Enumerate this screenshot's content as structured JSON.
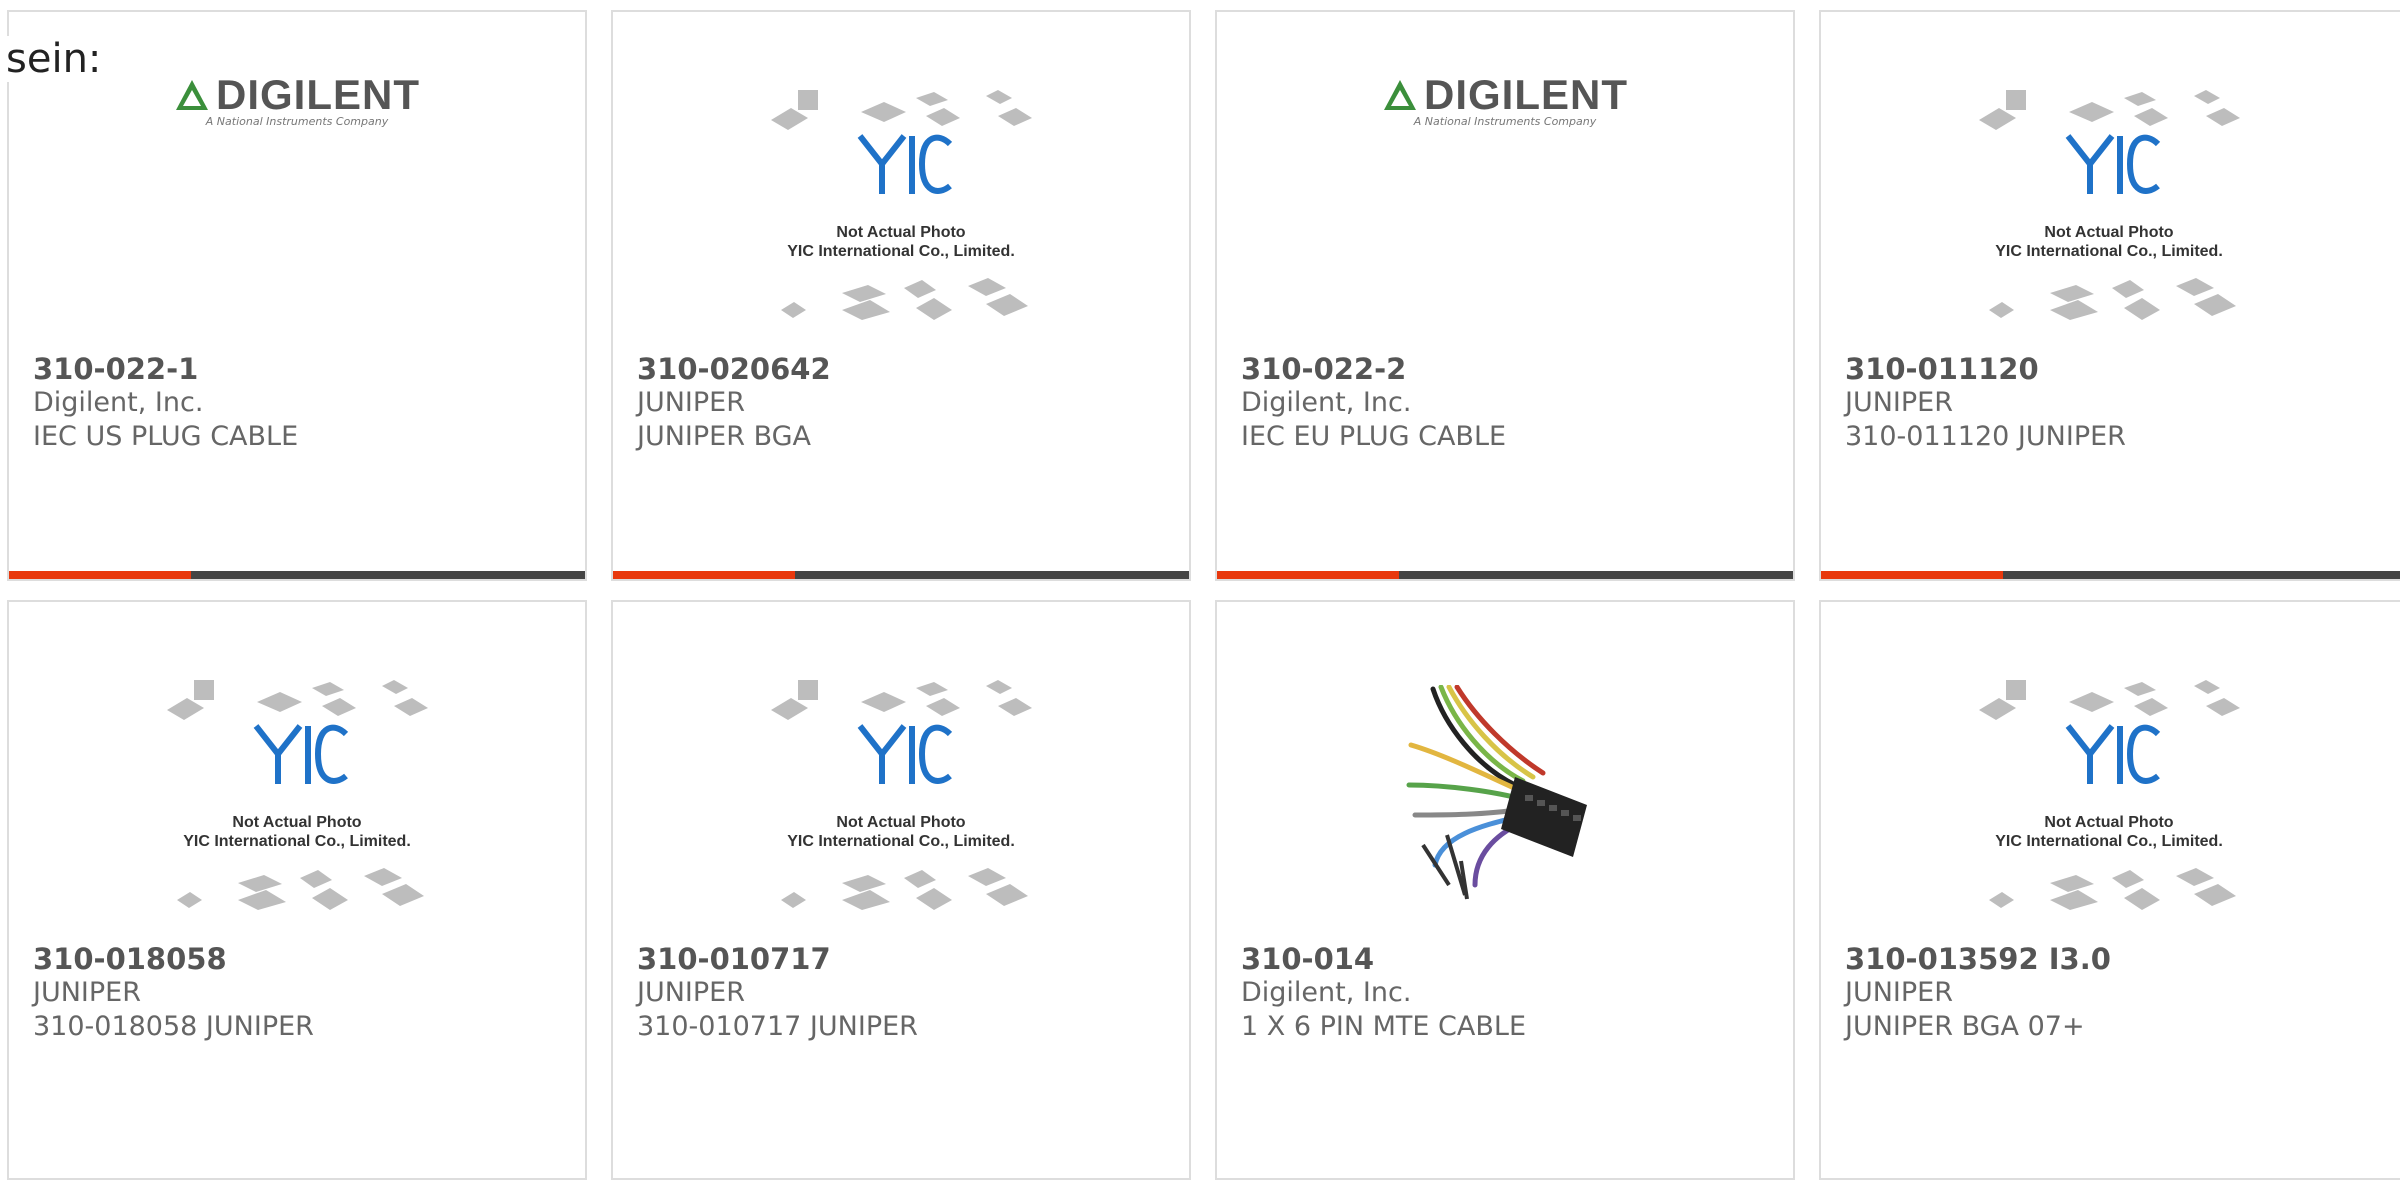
{
  "lead_text": "sein:",
  "placeholder_caption": {
    "line1": "Not Actual Photo",
    "line2": "YIC International Co., Limited."
  },
  "digilent_logo": {
    "word": "DIGILENT",
    "tagline": "A National Instruments Company"
  },
  "products": [
    {
      "part": "310-022-1",
      "manufacturer": "Digilent, Inc.",
      "description": "IEC US PLUG CABLE",
      "image": "digilent-logo"
    },
    {
      "part": "310-020642",
      "manufacturer": "JUNIPER",
      "description": "JUNIPER BGA",
      "image": "yic-placeholder"
    },
    {
      "part": "310-022-2",
      "manufacturer": "Digilent, Inc.",
      "description": "IEC EU PLUG CABLE",
      "image": "digilent-logo"
    },
    {
      "part": "310-011120",
      "manufacturer": "JUNIPER",
      "description": "310-011120 JUNIPER",
      "image": "yic-placeholder"
    },
    {
      "part": "310-018058",
      "manufacturer": "JUNIPER",
      "description": "310-018058 JUNIPER",
      "image": "yic-placeholder"
    },
    {
      "part": "310-010717",
      "manufacturer": "JUNIPER",
      "description": "310-010717 JUNIPER",
      "image": "yic-placeholder"
    },
    {
      "part": "310-014",
      "manufacturer": "Digilent, Inc.",
      "description": "1 X 6 PIN MTE CABLE",
      "image": "wire-cable-photo"
    },
    {
      "part": "310-013592 I3.0",
      "manufacturer": "JUNIPER",
      "description": "JUNIPER BGA 07+",
      "image": "yic-placeholder"
    }
  ],
  "colors": {
    "accent": "#e8380d",
    "bar": "#444444",
    "border": "#dddddd",
    "yic_blue": "#1f72c8"
  }
}
